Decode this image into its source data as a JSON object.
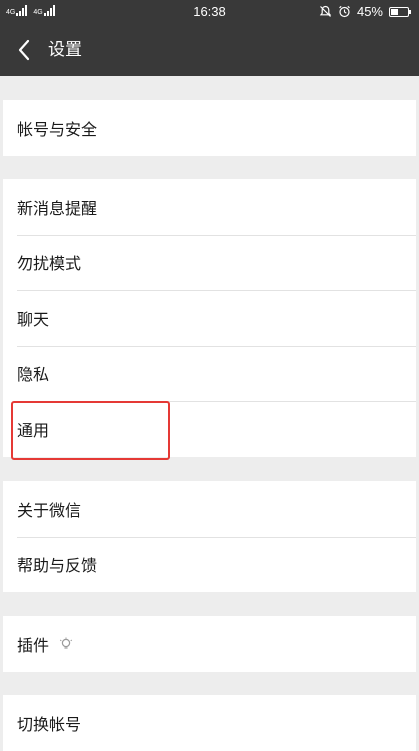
{
  "status_bar": {
    "network_labels": [
      "4G",
      "4G"
    ],
    "time": "16:38",
    "battery_percent": "45%",
    "battery_level": 0.45,
    "icons": [
      "signal-icon",
      "signal-icon",
      "notification-off-icon",
      "alarm-icon",
      "battery-icon"
    ]
  },
  "nav": {
    "title": "设置",
    "back_icon": "back-arrow-icon"
  },
  "groups": [
    {
      "items": [
        "帐号与安全"
      ]
    },
    {
      "items": [
        "新消息提醒",
        "勿扰模式",
        "聊天",
        "隐私",
        "通用"
      ]
    },
    {
      "items": [
        "关于微信",
        "帮助与反馈"
      ]
    },
    {
      "items": [
        "插件"
      ]
    },
    {
      "items": [
        "切换帐号"
      ]
    }
  ],
  "highlight": {
    "target": "通用",
    "color": "#e53935"
  },
  "colors": {
    "header_bg": "#393939",
    "page_bg": "#ededed",
    "row_bg": "#ffffff",
    "text": "#1a1a1a"
  }
}
